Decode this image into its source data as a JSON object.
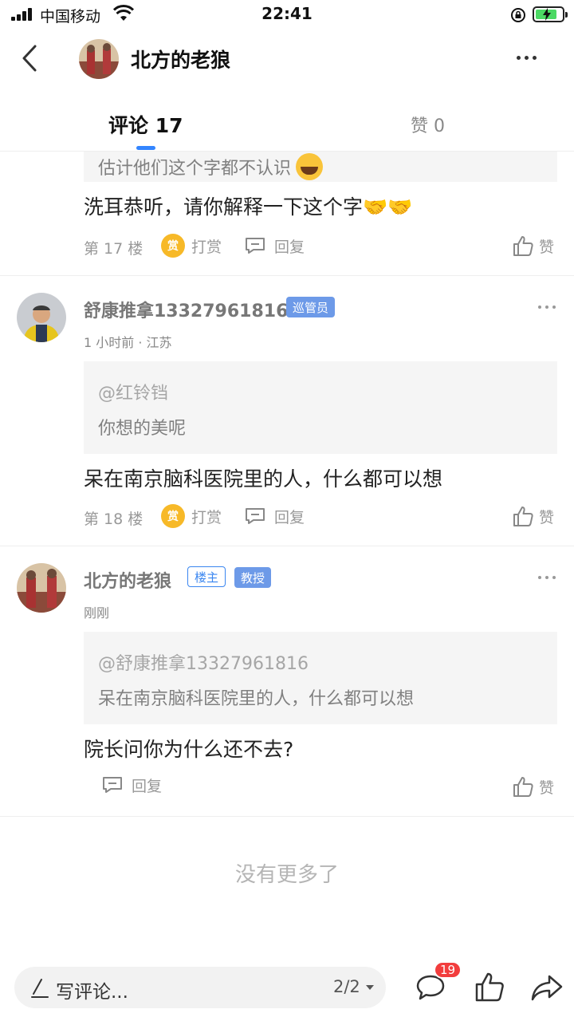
{
  "status_bar": {
    "carrier": "中国移动",
    "time": "22:41"
  },
  "header": {
    "title": "北方的老狼"
  },
  "tabs": {
    "comments": "评论 17",
    "likes": "赞 0"
  },
  "comments": [
    {
      "partial_quote": "估计他们这个字都不认识",
      "text": "洗耳恭听，请你解释一下这个字🤝🤝",
      "floor": "第 17 楼",
      "reward_label": "打赏",
      "reward_icon": "赏",
      "reply_label": "回复",
      "like_label": "赞"
    },
    {
      "username": "舒康推拿13327961816",
      "badge": "巡管员",
      "meta": "1 小时前 · 江苏",
      "quote_user": "@红铃铛",
      "quote_text": "你想的美呢",
      "text": "呆在南京脑科医院里的人，什么都可以想",
      "floor": "第 18 楼",
      "reward_label": "打赏",
      "reward_icon": "赏",
      "reply_label": "回复",
      "like_label": "赞"
    },
    {
      "username": "北方的老狼",
      "badges": [
        "楼主",
        "教授"
      ],
      "meta": "刚刚",
      "quote_user": "@舒康推拿13327961816",
      "quote_text": "呆在南京脑科医院里的人，什么都可以想",
      "text": "院长问你为什么还不去?",
      "reply_label": "回复",
      "like_label": "赞"
    }
  ],
  "footer": {
    "no_more": "没有更多了"
  },
  "bottom_bar": {
    "input_placeholder": "写评论...",
    "page": "2/2",
    "comment_count": "19"
  },
  "colors": {
    "accent": "#3385ff",
    "badge_red": "#f23d3d",
    "coin": "#f7b928"
  }
}
